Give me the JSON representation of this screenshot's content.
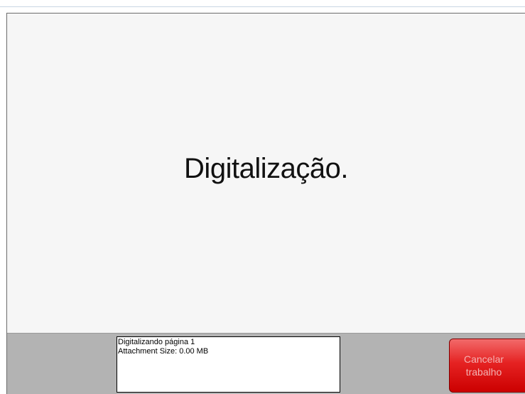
{
  "main": {
    "status_title": "Digitalização."
  },
  "info_box": {
    "line1": "Digitalizando página 1",
    "line2": "Attachment Size: 0.00 MB"
  },
  "cancel_button": {
    "line1": "Cancelar",
    "line2": "trabalho"
  },
  "colors": {
    "screen_background": "#f6f6f6",
    "bottom_bar": "#b3b3b3",
    "cancel_button": "#e52222"
  }
}
